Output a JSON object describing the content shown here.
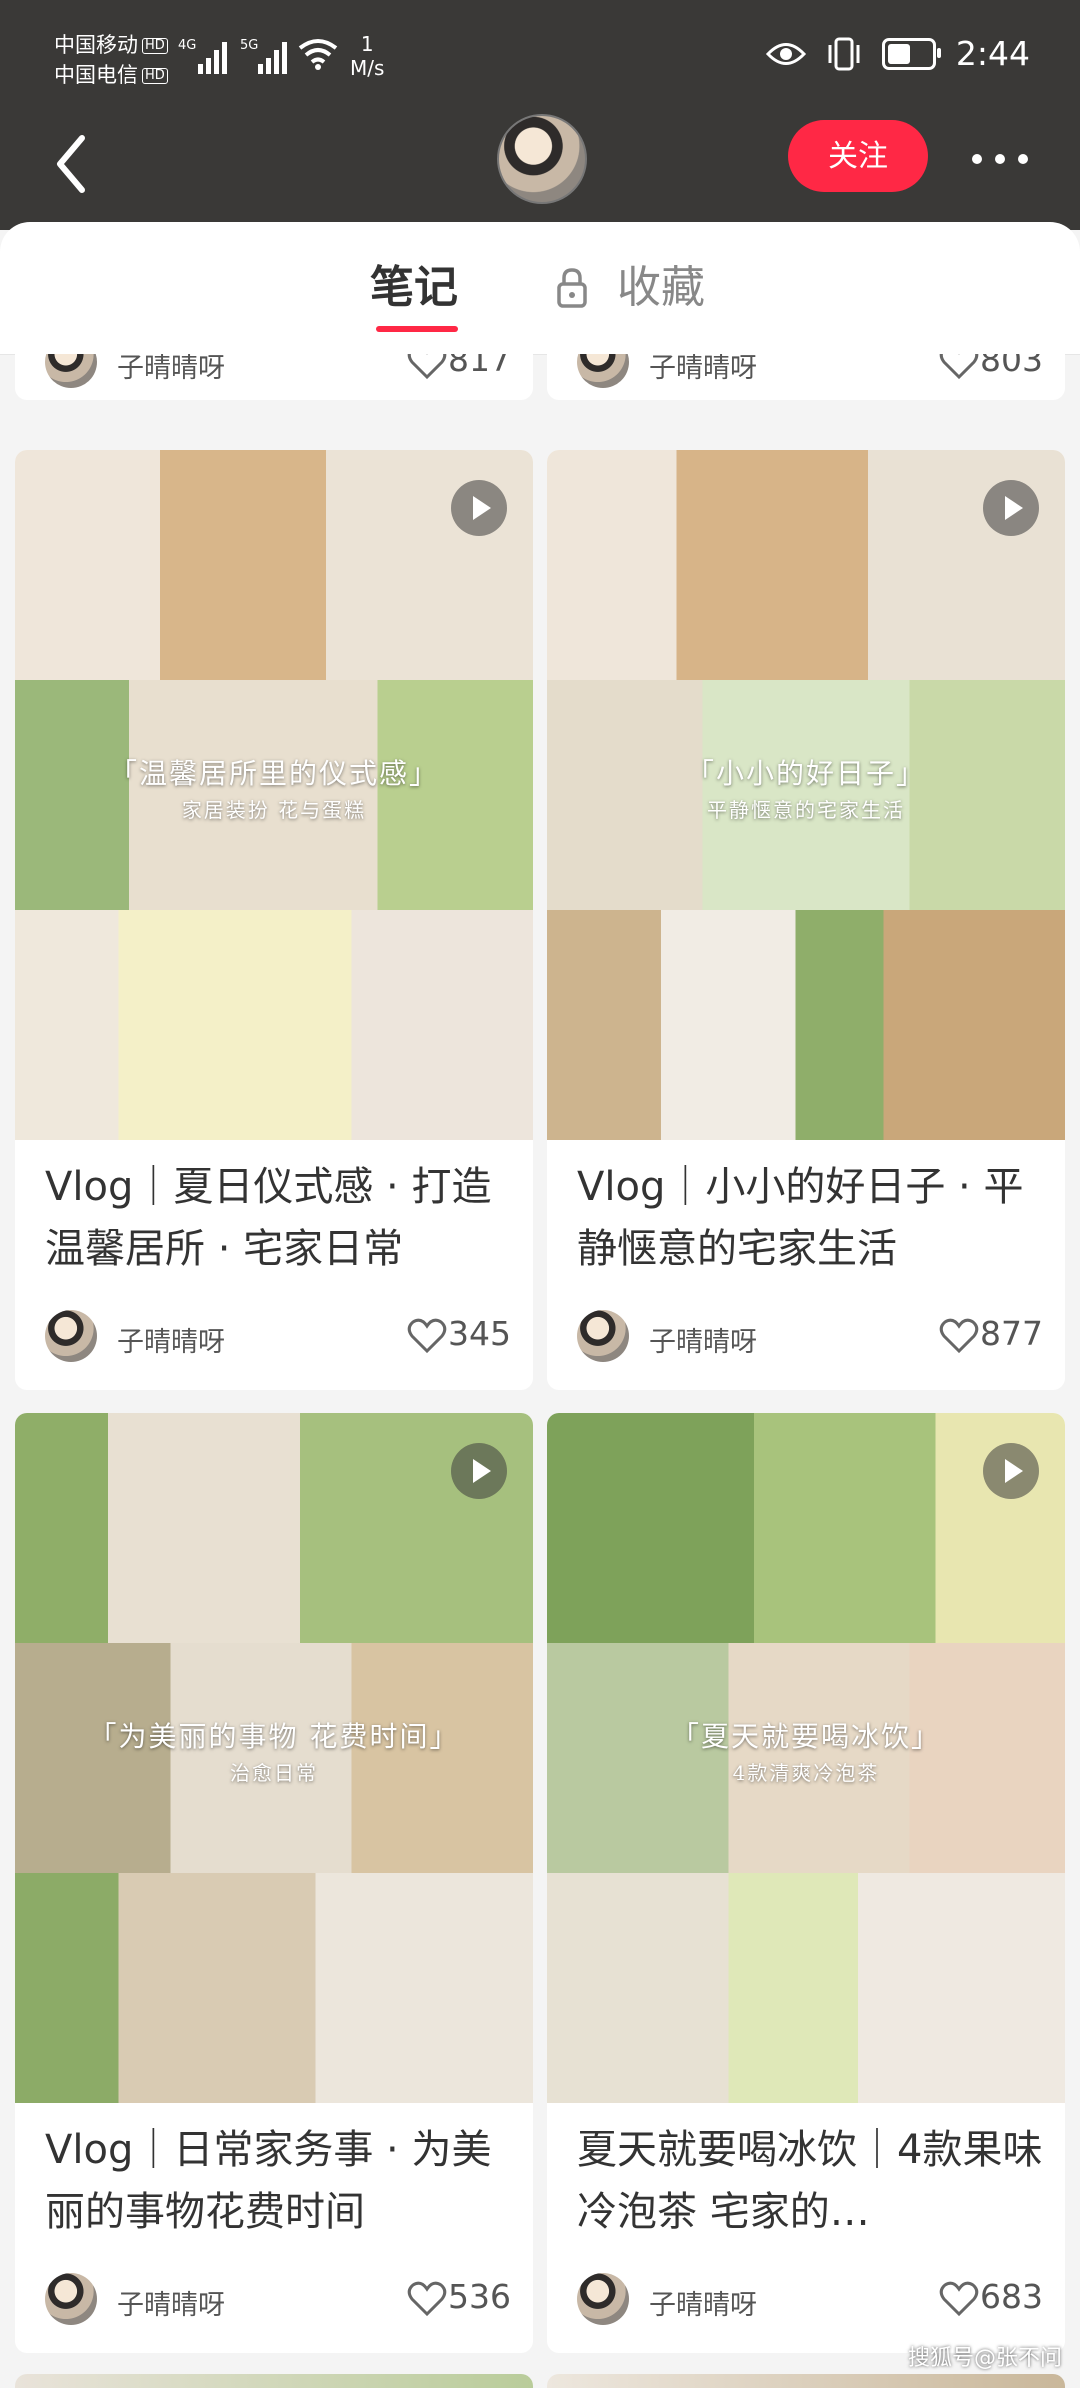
{
  "status_bar": {
    "carrier1": "中国移动",
    "carrier2": "中国电信",
    "hd": "HD",
    "net1": "4G",
    "net2": "5G",
    "speed_value": "1",
    "speed_unit": "M/s",
    "time": "2:44"
  },
  "header": {
    "follow_label": "关注"
  },
  "tabs": [
    {
      "label": "笔记",
      "active": true
    },
    {
      "label": "收藏",
      "active": false,
      "locked": true
    }
  ],
  "colors": {
    "accent": "#ff2845",
    "header_bg": "#3a3937"
  },
  "feed": {
    "partial": [
      {
        "author": "子晴晴呀",
        "likes": "817"
      },
      {
        "author": "子晴晴呀",
        "likes": "803"
      }
    ],
    "cards": [
      {
        "title": "Vlog｜夏日仪式感 · 打造温馨居所 · 宅家日常",
        "overlay_title": "「温馨居所里的仪式感」",
        "overlay_sub": "家居装扮 花与蛋糕",
        "author": "子晴晴呀",
        "likes": "345",
        "video": true
      },
      {
        "title": "Vlog｜小小的好日子 · 平静惬意的宅家生活",
        "overlay_title": "「小小的好日子」",
        "overlay_sub": "平静惬意的宅家生活",
        "author": "子晴晴呀",
        "likes": "877",
        "video": true
      },
      {
        "title": "Vlog｜日常家务事 · 为美丽的事物花费时间",
        "overlay_title": "「为美丽的事物 花费时间」",
        "overlay_sub": "治愈日常",
        "author": "子晴晴呀",
        "likes": "536",
        "video": true
      },
      {
        "title": "夏天就要喝冰饮｜4款果味冷泡茶 宅家的…",
        "overlay_title": "「夏天就要喝冰饮」",
        "overlay_sub": "4款清爽冷泡茶",
        "author": "子晴晴呀",
        "likes": "683",
        "video": true
      }
    ]
  },
  "watermark": "搜狐号@张不问"
}
